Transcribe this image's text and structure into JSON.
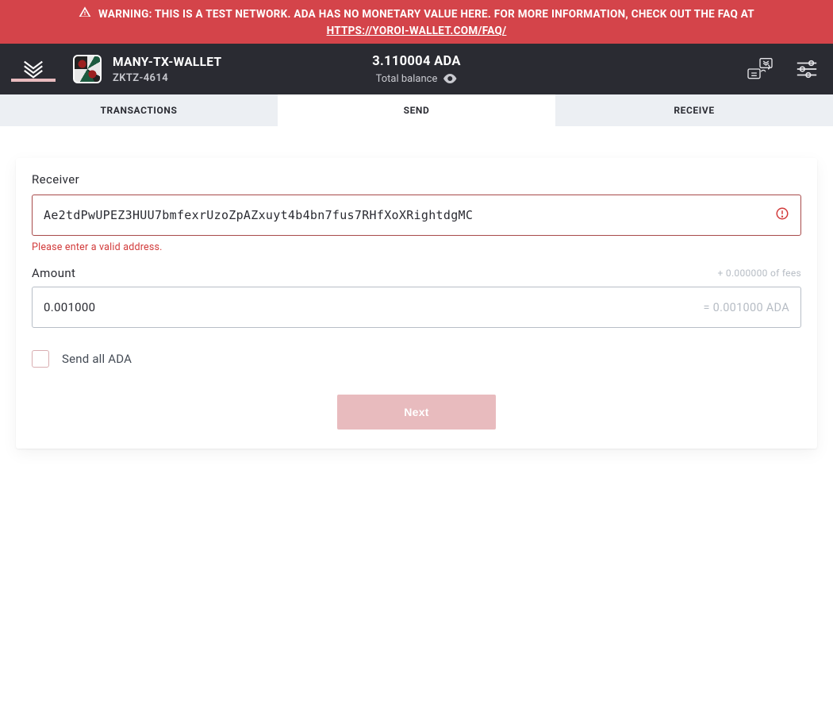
{
  "warning": {
    "text": "WARNING: THIS IS A TEST NETWORK. ADA HAS NO MONETARY VALUE HERE. FOR MORE INFORMATION, CHECK OUT THE FAQ AT",
    "link_label": "HTTPS://YOROI-WALLET.COM/FAQ/"
  },
  "wallet": {
    "name": "MANY-TX-WALLET",
    "id": "ZKTZ-4614"
  },
  "balance": {
    "amount": "3.110004 ADA",
    "label": "Total balance"
  },
  "tabs": {
    "transactions": "TRANSACTIONS",
    "send": "SEND",
    "receive": "RECEIVE"
  },
  "form": {
    "receiver_label": "Receiver",
    "receiver_value": "Ae2tdPwUPEZ3HUU7bmfexrUzoZpAZxuyt4b4bn7fus7RHfXoXRightdgMC",
    "receiver_error": "Please enter a valid address.",
    "amount_label": "Amount",
    "fees_hint": "+ 0.000000 of fees",
    "amount_value": "0.001000",
    "ada_equiv": "= 0.001000 ADA",
    "sendall_label": "Send all ADA",
    "next_label": "Next"
  }
}
